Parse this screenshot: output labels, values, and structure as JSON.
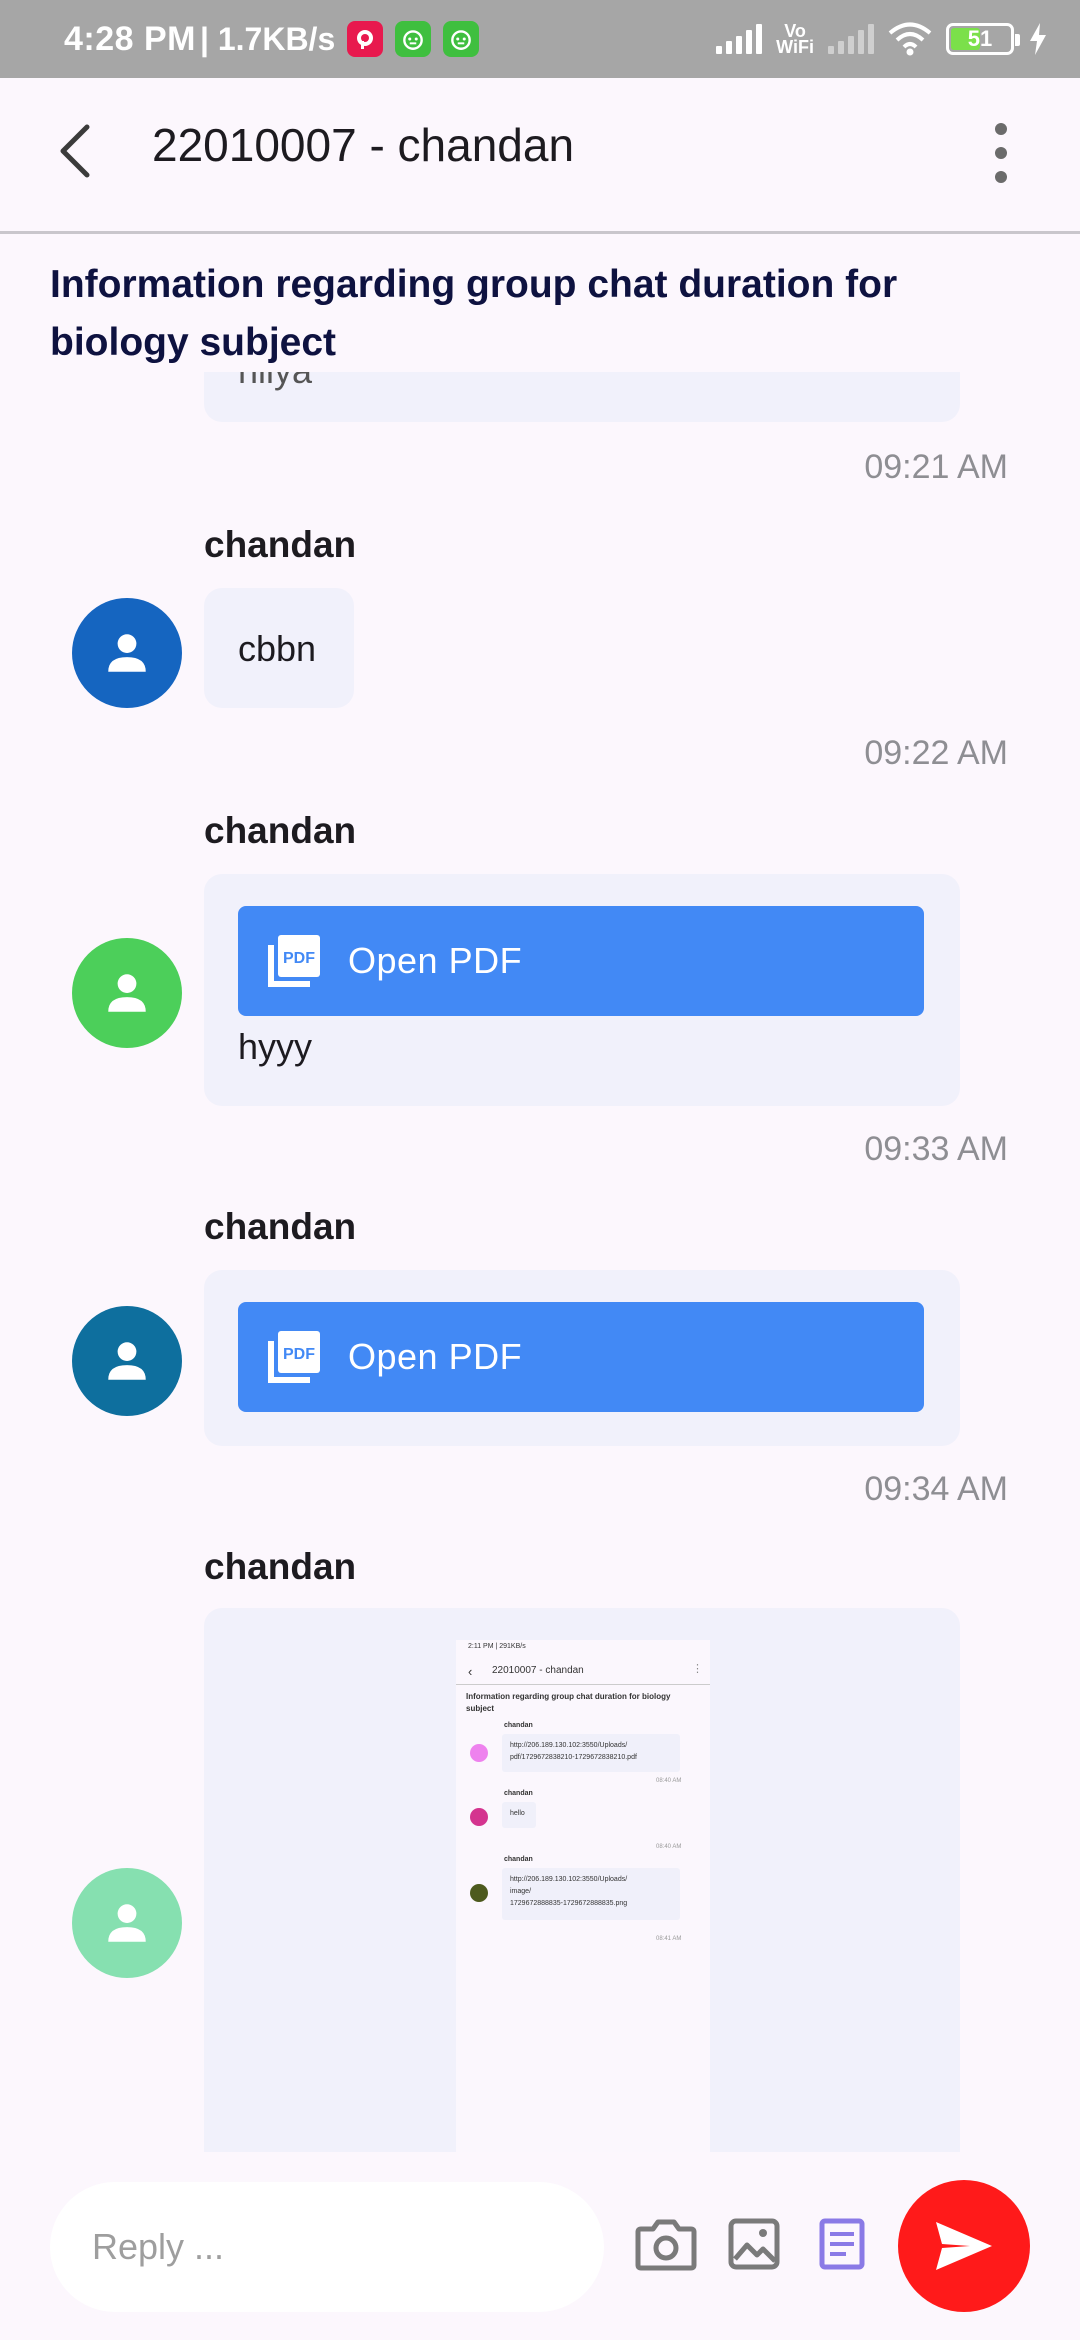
{
  "status_bar": {
    "time": "4:28 PM",
    "speed": "| 1.7KB/s",
    "vowifi_1": "Vo",
    "vowifi_2": "WiFi",
    "battery": "51"
  },
  "app_bar": {
    "title": "22010007 - chandan"
  },
  "subject": "Information regarding group chat duration for biology subject",
  "messages": [
    {
      "partial_text": "hiiya",
      "time": "09:21 AM"
    },
    {
      "sender": "chandan",
      "text": "cbbn",
      "time": "09:22 AM",
      "avatar_color": "#1565c0"
    },
    {
      "sender": "chandan",
      "pdf_label": "Open PDF",
      "text": "hyyy",
      "time": "09:33 AM",
      "avatar_color": "#4ccf5a"
    },
    {
      "sender": "chandan",
      "pdf_label": "Open PDF",
      "time": "09:34 AM",
      "avatar_color": "#0e6f9e"
    },
    {
      "sender": "chandan",
      "avatar_color": "#86e0b0"
    }
  ],
  "embedded_screenshot": {
    "status": "2:11 PM | 291KB/s",
    "title": "22010007 - chandan",
    "subject_1": "Information regarding group chat duration for biology",
    "subject_2": "subject",
    "items": [
      {
        "sender": "chandan",
        "line1": "http://206.189.130.102:3550/Uploads/",
        "line2": "pdf/1729672838210-1729672838210.pdf",
        "time": "08:40 AM"
      },
      {
        "sender": "chandan",
        "line1": "hello",
        "time": "08:40 AM"
      },
      {
        "sender": "chandan",
        "line1": "http://206.189.130.102:3550/Uploads/",
        "line2": "image/",
        "line3": "1729672888835-1729672888835.png",
        "time": "08:41 AM"
      }
    ]
  },
  "reply": {
    "placeholder": "Reply ..."
  },
  "colors": {
    "accent_blue": "#4289f5",
    "send_red": "#ff1a1a",
    "bubble": "#f1f1fb"
  }
}
